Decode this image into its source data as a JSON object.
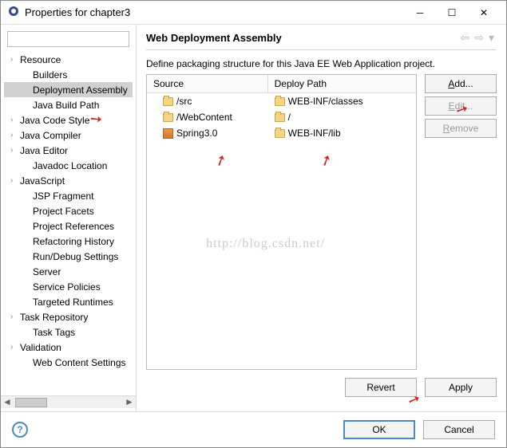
{
  "titlebar": {
    "title": "Properties for chapter3"
  },
  "sidebar": {
    "items": [
      {
        "label": "Resource",
        "expandable": true
      },
      {
        "label": "Builders"
      },
      {
        "label": "Deployment Assembly",
        "selected": true
      },
      {
        "label": "Java Build Path"
      },
      {
        "label": "Java Code Style",
        "expandable": true
      },
      {
        "label": "Java Compiler",
        "expandable": true
      },
      {
        "label": "Java Editor",
        "expandable": true
      },
      {
        "label": "Javadoc Location"
      },
      {
        "label": "JavaScript",
        "expandable": true
      },
      {
        "label": "JSP Fragment"
      },
      {
        "label": "Project Facets"
      },
      {
        "label": "Project References"
      },
      {
        "label": "Refactoring History"
      },
      {
        "label": "Run/Debug Settings"
      },
      {
        "label": "Server"
      },
      {
        "label": "Service Policies"
      },
      {
        "label": "Targeted Runtimes"
      },
      {
        "label": "Task Repository",
        "expandable": true
      },
      {
        "label": "Task Tags"
      },
      {
        "label": "Validation",
        "expandable": true
      },
      {
        "label": "Web Content Settings"
      }
    ]
  },
  "main": {
    "heading": "Web Deployment Assembly",
    "description": "Define packaging structure for this Java EE Web Application project.",
    "columns": {
      "source": "Source",
      "deploy": "Deploy Path"
    },
    "rows": [
      {
        "source": "/src",
        "deploy": "WEB-INF/classes",
        "icon": "folder"
      },
      {
        "source": "/WebContent",
        "deploy": "/",
        "icon": "folder"
      },
      {
        "source": "Spring3.0",
        "deploy": "WEB-INF/lib",
        "icon": "lib"
      }
    ],
    "buttons": {
      "add": "Add...",
      "edit": "Edit...",
      "remove": "Remove"
    },
    "revert": "Revert",
    "apply": "Apply"
  },
  "footer": {
    "ok": "OK",
    "cancel": "Cancel"
  },
  "watermark": "http://blog.csdn.net/"
}
